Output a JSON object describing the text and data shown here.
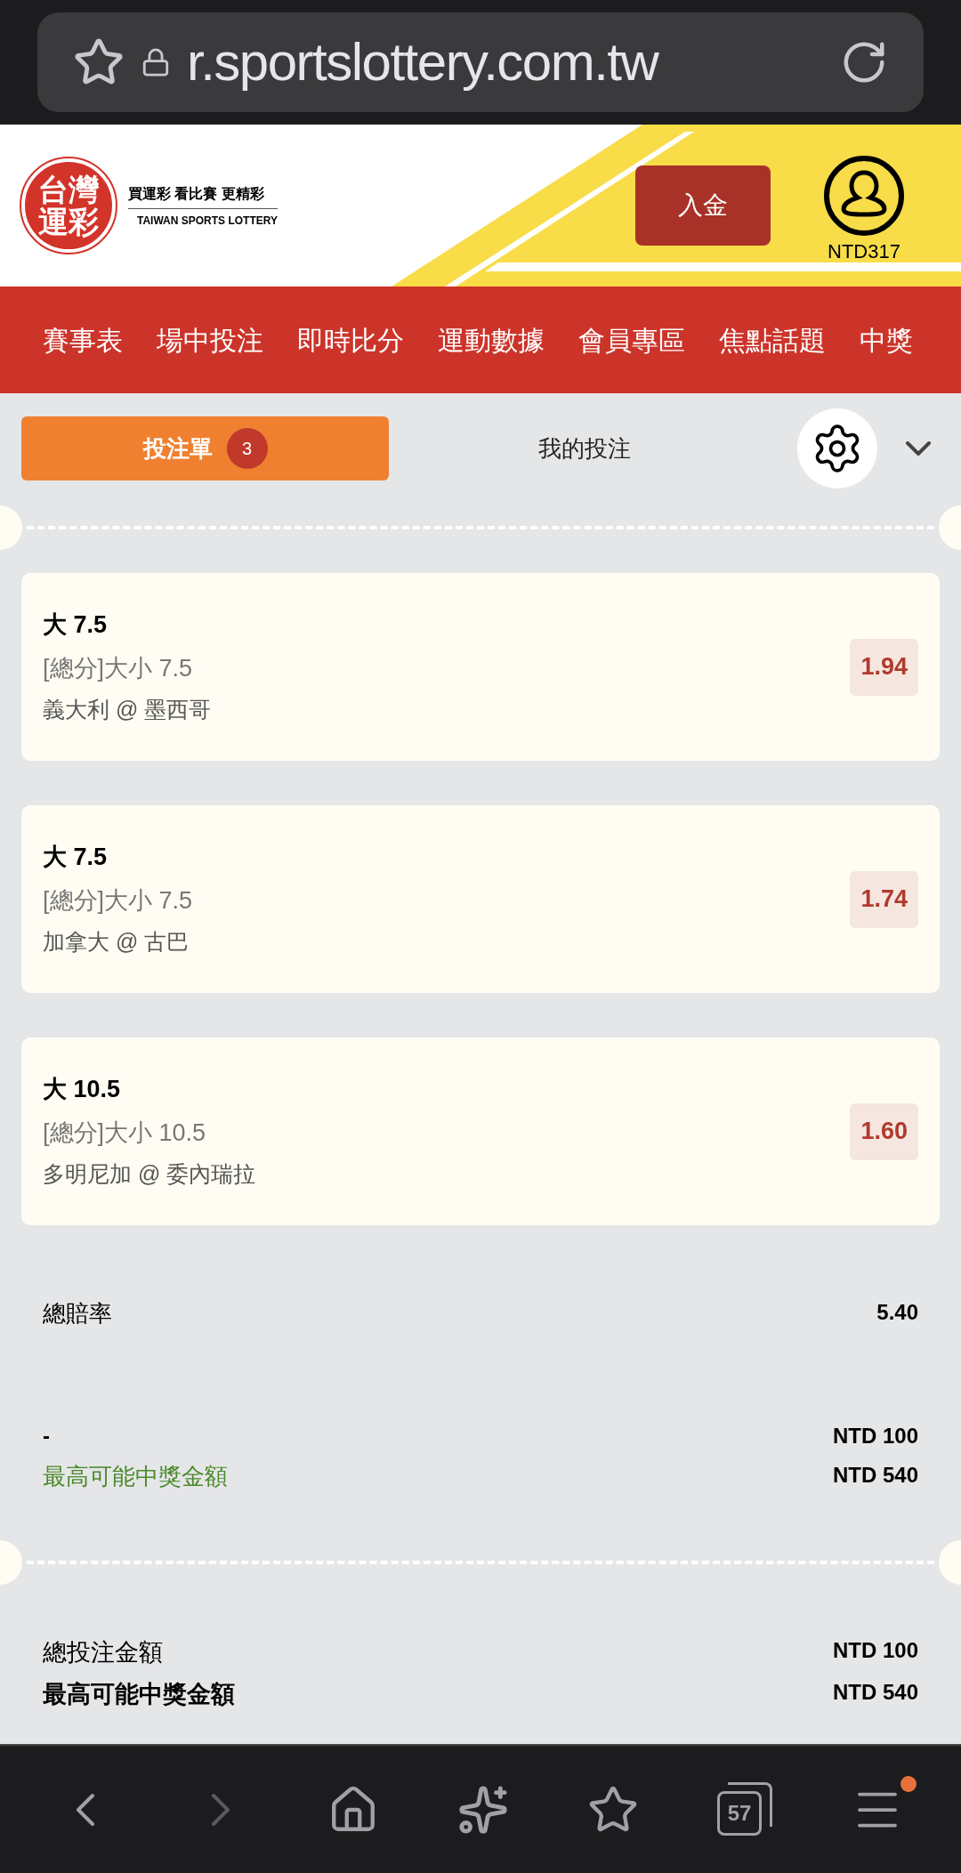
{
  "browser": {
    "url": "r.sportslottery.com.tw"
  },
  "header": {
    "logo_text": "台灣運彩",
    "tagline": "買運彩 看比賽 更精彩",
    "subtitle": "TAIWAN SPORTS LOTTERY",
    "deposit_button": "入金",
    "balance": "NTD317"
  },
  "nav": [
    {
      "label": "賽事表"
    },
    {
      "label": "場中投注"
    },
    {
      "label": "即時比分"
    },
    {
      "label": "運動數據"
    },
    {
      "label": "會員專區"
    },
    {
      "label": "焦點話題"
    },
    {
      "label": "中獎"
    }
  ],
  "tabs": [
    {
      "label": "投注單",
      "badge": "3",
      "selected": true
    },
    {
      "label": "我的投注",
      "selected": false
    }
  ],
  "bets": [
    {
      "selection": "大 7.5",
      "market": "[總分]大小 7.5",
      "match": "義大利 @ 墨西哥",
      "odds": "1.94"
    },
    {
      "selection": "大 7.5",
      "market": "[總分]大小 7.5",
      "match": "加拿大 @ 古巴",
      "odds": "1.74"
    },
    {
      "selection": "大 10.5",
      "market": "[總分]大小 10.5",
      "match": "多明尼加 @ 委內瑞拉",
      "odds": "1.60"
    }
  ],
  "total_odds": {
    "label": "總賠率",
    "value": "5.40"
  },
  "stake": {
    "label": "-",
    "value": "NTD 100"
  },
  "potential": {
    "label": "最高可能中獎金額",
    "value": "NTD 540"
  },
  "summary": [
    {
      "label": "總投注金額",
      "value": "NTD 100",
      "bold": false
    },
    {
      "label": "最高可能中獎金額",
      "value": "NTD 540",
      "bold": true
    }
  ],
  "bottom_bar": {
    "tab_count": "57",
    "menu_badge": true
  }
}
